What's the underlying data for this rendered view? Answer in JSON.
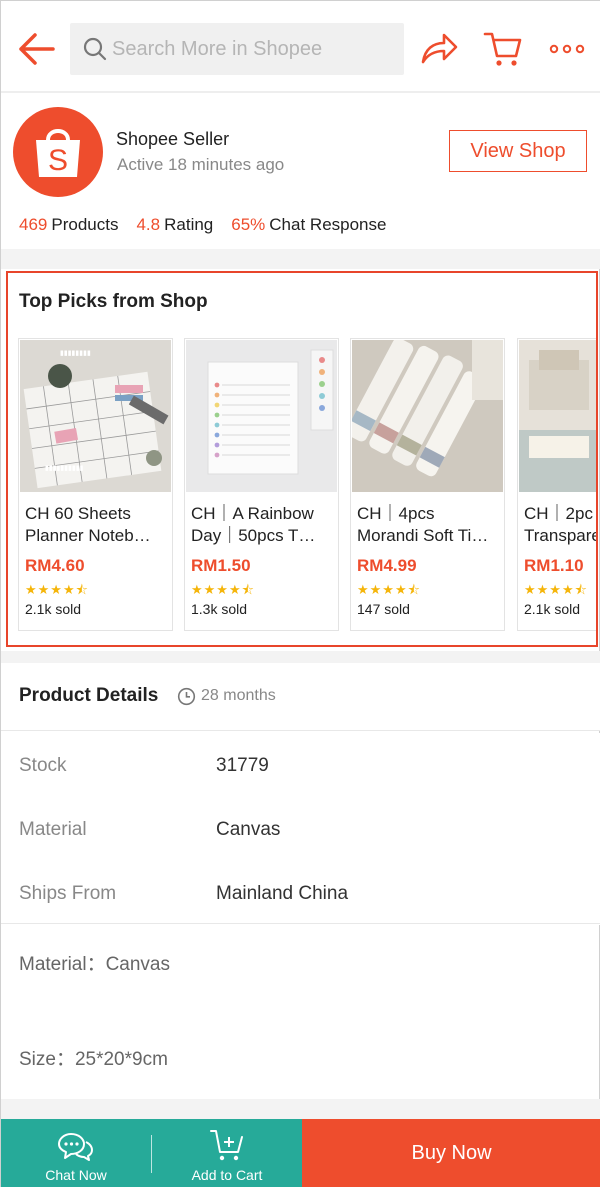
{
  "colors": {
    "brand": "#ee4d2d",
    "green": "#26aa99",
    "star": "#f5b50a"
  },
  "header": {
    "back_icon": "arrow-left-icon",
    "search_placeholder": "Search More in Shopee",
    "share_icon": "share-icon",
    "cart_icon": "cart-icon",
    "more_icon": "more-dots-icon"
  },
  "shop": {
    "logo_letter": "S",
    "name": "Shopee Seller",
    "active": "Active 18 minutes ago",
    "view_shop": "View Shop",
    "stats": [
      {
        "value": "469",
        "label": "Products"
      },
      {
        "value": "4.8",
        "label": "Rating"
      },
      {
        "value": "65%",
        "label": "Chat Response"
      }
    ]
  },
  "top_picks": {
    "title": "Top Picks from Shop",
    "products": [
      {
        "line1": "CH 60 Sheets",
        "line2": "Planner Noteb…",
        "price": "RM4.60",
        "rating": 4.5,
        "sold": "2.1k sold"
      },
      {
        "line1": "CH｜A Rainbow",
        "line2": "Day｜50pcs T…",
        "price": "RM1.50",
        "rating": 4.5,
        "sold": "1.3k sold"
      },
      {
        "line1": "CH｜4pcs",
        "line2": "Morandi Soft Ti…",
        "price": "RM4.99",
        "rating": 4.5,
        "sold": "147 sold"
      },
      {
        "line1": "CH｜2pc",
        "line2": "Transpare",
        "price": "RM1.10",
        "rating": 4.5,
        "sold": "2.1k sold"
      }
    ]
  },
  "details": {
    "title": "Product Details",
    "age": "28 months",
    "rows": [
      {
        "label": "Stock",
        "value": "31779"
      },
      {
        "label": "Material",
        "value": "Canvas"
      },
      {
        "label": "Ships From",
        "value": "Mainland China"
      }
    ],
    "description": [
      "Material：Canvas",
      "Size：25*20*9cm"
    ]
  },
  "bottom_bar": {
    "chat_now": "Chat Now",
    "add_to_cart": "Add to Cart",
    "buy_now": "Buy Now"
  }
}
